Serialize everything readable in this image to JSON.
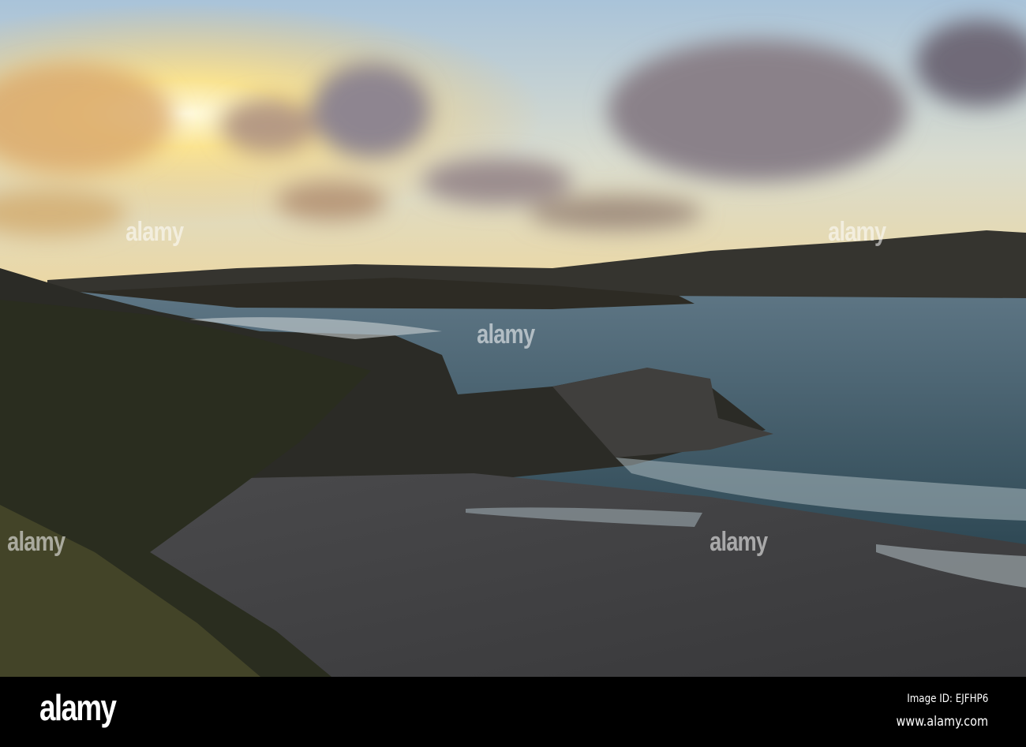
{
  "watermark": {
    "brand": "alamy"
  },
  "footer": {
    "logo": "alamy",
    "image_id": "Image ID: EJFHP6",
    "url": "www.alamy.com"
  }
}
